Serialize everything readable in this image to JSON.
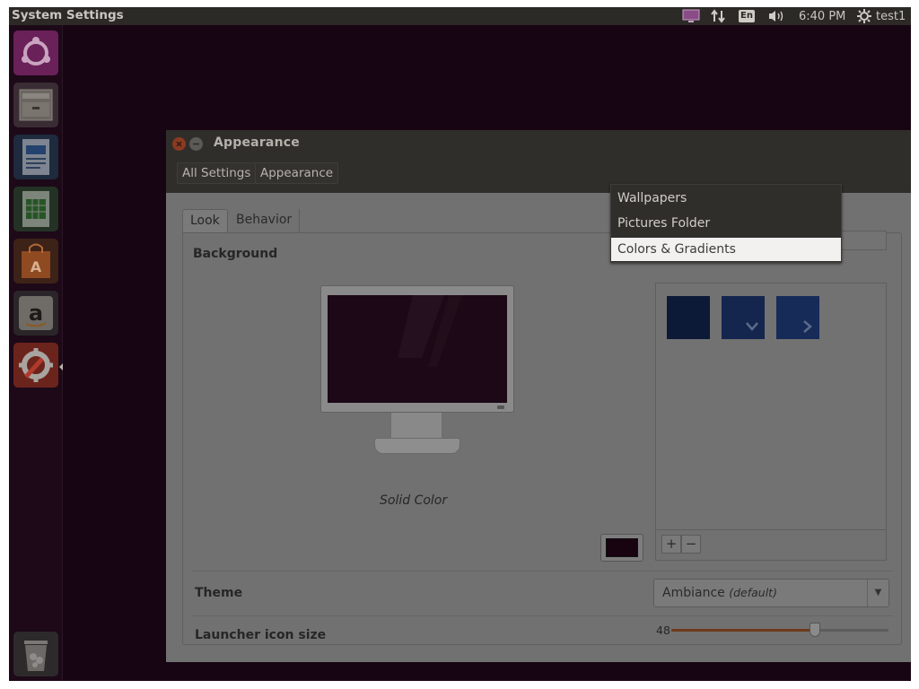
{
  "top_panel": {
    "title": "System Settings",
    "keyboard_layout": "En",
    "clock": "6:40 PM",
    "user": "test1"
  },
  "launcher": {
    "items": [
      {
        "name": "Dash home",
        "icon": "ubuntu-logo-icon"
      },
      {
        "name": "Files",
        "icon": "file-cabinet-icon"
      },
      {
        "name": "LibreOffice Writer",
        "icon": "writer-document-icon"
      },
      {
        "name": "LibreOffice Calc",
        "icon": "spreadsheet-icon"
      },
      {
        "name": "Ubuntu Software Center",
        "icon": "shopping-bag-icon"
      },
      {
        "name": "Amazon",
        "icon": "amazon-icon"
      },
      {
        "name": "System Settings",
        "icon": "settings-wrench-icon"
      },
      {
        "name": "Trash",
        "icon": "trash-icon"
      }
    ]
  },
  "window": {
    "title": "Appearance",
    "breadcrumbs": [
      "All Settings",
      "Appearance"
    ],
    "tabs": [
      {
        "label": "Look",
        "active": true
      },
      {
        "label": "Behavior",
        "active": false
      }
    ],
    "background_label": "Background",
    "preview_caption": "Solid Color",
    "swatch_color": "#180311",
    "wallpaper_source_menu": {
      "items": [
        "Wallpapers",
        "Pictures Folder",
        "Colors & Gradients"
      ],
      "highlighted": "Colors & Gradients"
    },
    "thumbnails": [
      {
        "name": "solid",
        "color": "#0c1a37"
      },
      {
        "name": "vertical-gradient",
        "color": "#14254e"
      },
      {
        "name": "horizontal-gradient",
        "color": "#172b58"
      }
    ],
    "add_label": "+",
    "remove_label": "−",
    "theme_label": "Theme",
    "theme_value": "Ambiance",
    "theme_default_note": "(default)",
    "launcher_size_label": "Launcher icon size",
    "launcher_size_value": "48",
    "launcher_size_fraction": 0.66
  },
  "colors": {
    "accent": "#e05a1a",
    "desktop": "#2c0a24",
    "panel": "#2c2a27"
  }
}
